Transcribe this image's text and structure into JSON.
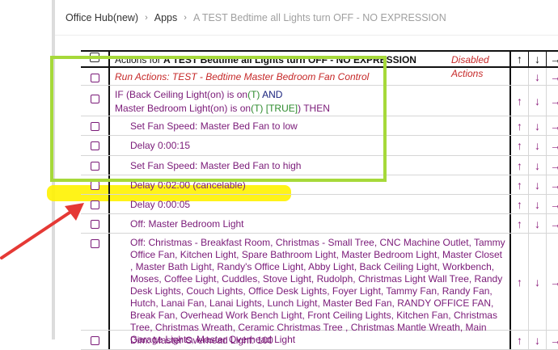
{
  "breadcrumb": {
    "home": "Office Hub(new)",
    "apps": "Apps",
    "current": "A TEST Bedtime all Lights turn OFF - NO EXPRESSION"
  },
  "table": {
    "header_prefix": "Actions for",
    "header_rule": "A TEST Bedtime  all Lights turn OFF  - NO EXPRESSION",
    "disabled_label": "Disabled Actions",
    "arrow_up": "↑",
    "arrow_down": "↓",
    "arrow_right": "→"
  },
  "rows": {
    "r1": "Run Actions: TEST - Bedtime  Master Bedroom Fan Control",
    "r2_line1_a": "IF (Back Ceiling Light(on) is on",
    "r2_line1_t": "(T)",
    "r2_line1_and": "  AND",
    "r2_line2_a": "Master Bedroom Light(on) is on",
    "r2_line2_t": "(T) [TRUE]",
    "r2_line2_b": ") THEN",
    "r3": "Set Fan Speed: Master Bed Fan to low",
    "r4": "Delay 0:00:15",
    "r5": "Set Fan Speed: Master Bed Fan to high",
    "r6": "Delay 0:02:00 (cancelable)",
    "r7": "Delay 0:00:05",
    "r8": "Off: Master Bedroom Light",
    "r9": "Off: Christmas - Breakfast Room, Christmas - Small Tree, CNC Machine Outlet, Tammy Office Fan, Kitchen Light, Spare Bathroom Light, Master Bedroom Light, Master Closet , Master Bath Light, Randy's Office Light, Abby Light, Back Ceiling Light, Workbench, Moses, Coffee Light, Cuddles, Stove Light, Rudolph, Christmas Light Wall Tree, Randy Desk Lights, Couch Lights, Office Desk Lights, Foyer Light, Tammy Fan, Randy Fan, Hutch, Lanai Fan, Lanai Lights, Lunch Light, Master Bed Fan, RANDY OFFICE FAN, Break Fan, Overhead Work Bench Light, Front Ceiling Lights, Kitchen Fan, Christmas Tree, Christmas Wreath, Ceramic Christmas Tree , Christmas Mantle Wreath, Main Garage Lights, Master Overhead Light",
    "r10": "Dim: Master Overhead Light: 100"
  },
  "colors": {
    "highlight": "#fff200",
    "annotation_box": "#a6d93a",
    "annotation_arrow": "#e53935",
    "action_text": "#7a1a78",
    "run_text": "#c62828"
  }
}
